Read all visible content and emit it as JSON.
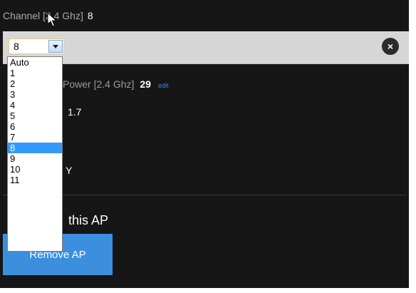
{
  "channel": {
    "label": "Channel [2.4 Ghz]",
    "value": "8",
    "select_value": "8",
    "options": [
      "Auto",
      "1",
      "2",
      "3",
      "4",
      "5",
      "6",
      "7",
      "8",
      "9",
      "10",
      "11"
    ],
    "selected_index": 8
  },
  "close_glyph": "×",
  "power": {
    "label": "Power [2.4 Ghz]",
    "value": "29",
    "edit_label": "edit"
  },
  "firmware_partial": "1.7",
  "partial_y": "Y",
  "remove": {
    "heading": "this AP",
    "button_label": "Remove AP"
  },
  "colors": {
    "panel_bg": "#161616",
    "bar_bg": "#d6d6d6",
    "accent_blue": "#3b8fdc",
    "selection_blue": "#3399ff",
    "edit_link": "#3d8be0"
  },
  "icons": {
    "dropdown_arrow": "chevron-down-icon",
    "close": "close-icon",
    "cursor": "mouse-pointer-icon"
  }
}
